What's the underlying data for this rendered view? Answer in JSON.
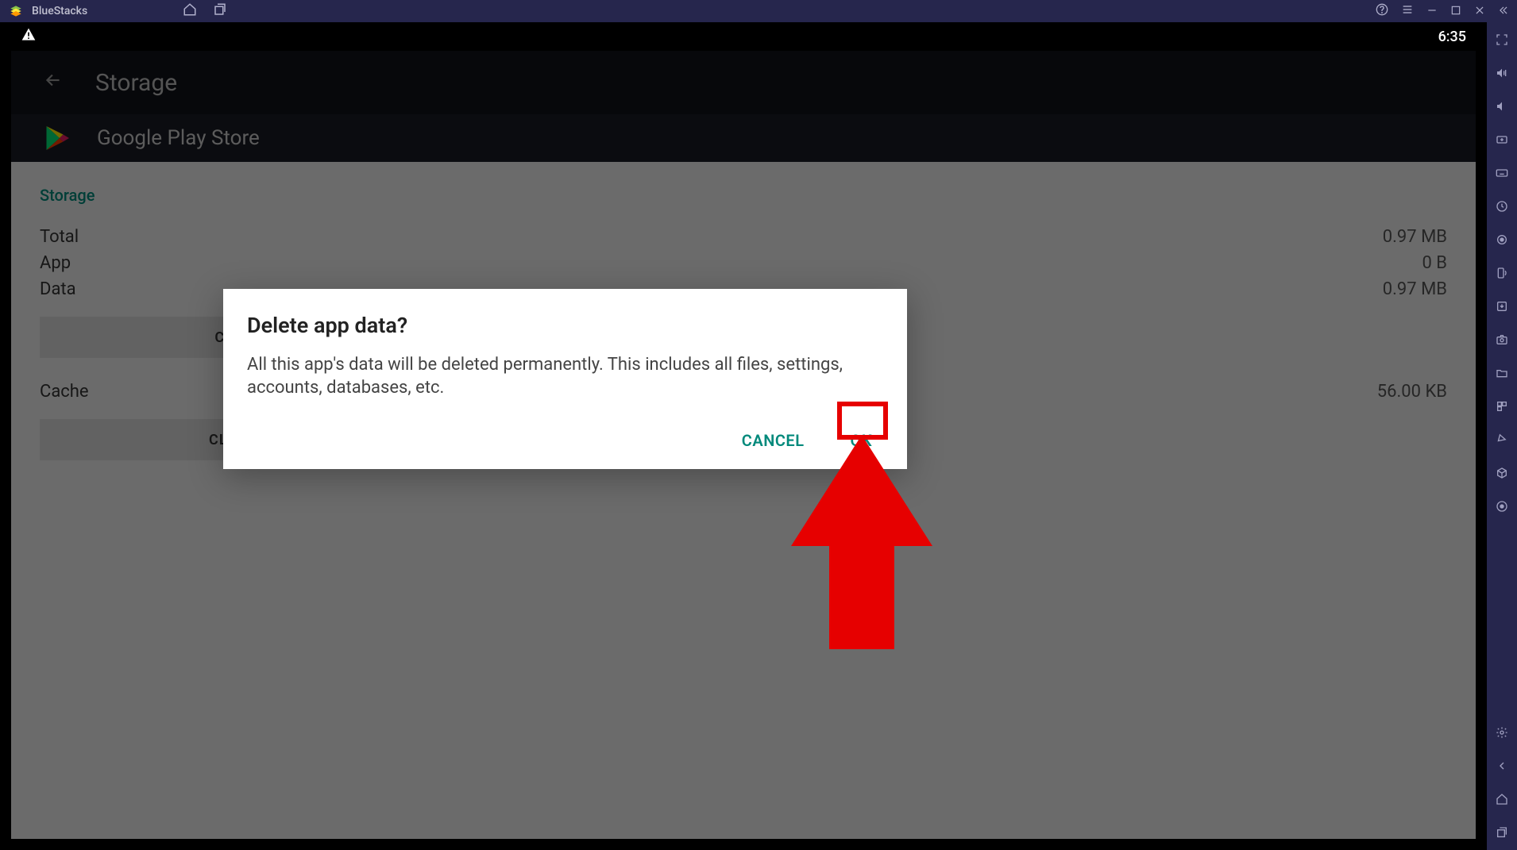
{
  "titlebar": {
    "app_name": "BlueStacks"
  },
  "statusbar": {
    "time": "6:35"
  },
  "settings": {
    "page_title": "Storage",
    "app_name": "Google Play Store",
    "section_label": "Storage",
    "rows": [
      {
        "label": "Total",
        "value": "0.97 MB"
      },
      {
        "label": "App",
        "value": "0 B"
      },
      {
        "label": "Data",
        "value": "0.97 MB"
      }
    ],
    "clear_data_label": "CLEAR DATA",
    "cache_row": {
      "label": "Cache",
      "value": "56.00 KB"
    },
    "clear_cache_label": "CLEAR CACHE"
  },
  "dialog": {
    "title": "Delete app data?",
    "body": "All this app's data will be deleted permanently. This includes all files, settings, accounts, databases, etc.",
    "cancel_label": "CANCEL",
    "ok_label": "OK"
  }
}
